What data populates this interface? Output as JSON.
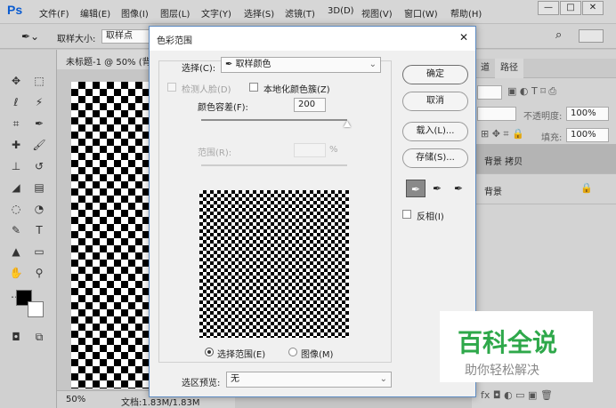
{
  "app": {
    "logo": "Ps",
    "menus": [
      "文件(F)",
      "编辑(E)",
      "图像(I)",
      "图层(L)",
      "文字(Y)",
      "选择(S)",
      "滤镜(T)",
      "3D(D)",
      "视图(V)",
      "窗口(W)",
      "帮助(H)"
    ],
    "window_controls": [
      "—",
      "□",
      "✕"
    ]
  },
  "options": {
    "sample_size_label": "取样大小:",
    "sample_size_value": "取样点"
  },
  "document": {
    "tab_title": "未标题-1 @ 50% (背",
    "zoom": "50%",
    "doc_info": "文档:1.83M/1.83M"
  },
  "layers_panel": {
    "tabs": [
      "道",
      "路径"
    ],
    "opacity_label": "不透明度:",
    "opacity_value": "100%",
    "fill_label": "填充:",
    "fill_value": "100%",
    "layers": [
      {
        "name": "背景 拷贝"
      },
      {
        "name": "背景"
      }
    ]
  },
  "dialog": {
    "title": "色彩范围",
    "select_label": "选择(C):",
    "select_value": "取样颜色",
    "detect_faces_label": "检测人脸(D)",
    "localized_label": "本地化颜色簇(Z)",
    "fuzziness_label": "颜色容差(F):",
    "fuzziness_value": "200",
    "fuzziness_fraction": 1.0,
    "range_label": "范围(R):",
    "range_unit": "%",
    "ok_label": "确定",
    "cancel_label": "取消",
    "load_label": "载入(L)...",
    "save_label": "存储(S)...",
    "invert_label": "反相(I)",
    "selection_radio_label": "选择范围(E)",
    "image_radio_label": "图像(M)",
    "preview_label": "选区预览:",
    "preview_value": "无"
  },
  "watermark": {
    "title": "百科全说",
    "subtitle": "助你轻松解决",
    "title_color": "#2ea84a"
  }
}
